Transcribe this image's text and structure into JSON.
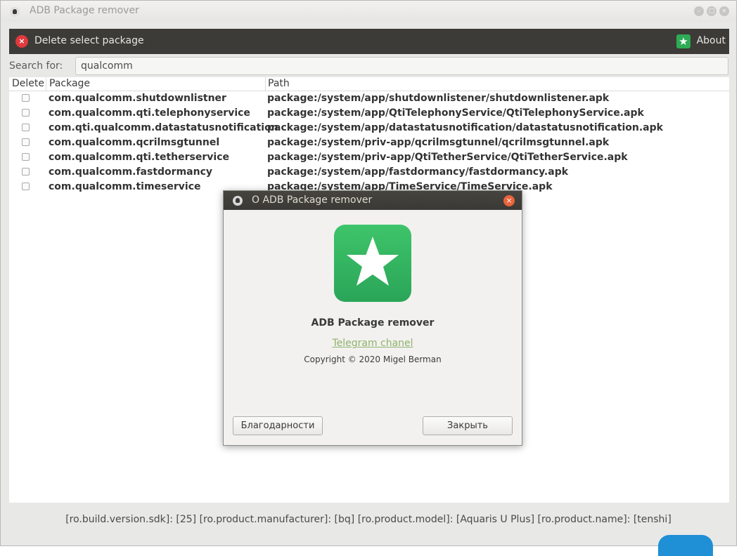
{
  "window": {
    "title": "ADB Package remover",
    "controls": [
      "–",
      "□",
      "×"
    ]
  },
  "toolbar": {
    "delete_label": "Delete select package",
    "about_label": "About",
    "delete_icon_glyph": "×",
    "about_icon_glyph": "★"
  },
  "search": {
    "label": "Search for:",
    "value": "qualcomm"
  },
  "table": {
    "headers": {
      "delete": "Delete",
      "package": "Package",
      "path": "Path"
    },
    "rows": [
      {
        "package": "com.qualcomm.shutdownlistner",
        "path": "package:/system/app/shutdownlistener/shutdownlistener.apk",
        "checked": false
      },
      {
        "package": "com.qualcomm.qti.telephonyservice",
        "path": "package:/system/app/QtiTelephonyService/QtiTelephonyService.apk",
        "checked": false
      },
      {
        "package": "com.qti.qualcomm.datastatusnotification",
        "path": "package:/system/app/datastatusnotification/datastatusnotification.apk",
        "checked": false
      },
      {
        "package": "com.qualcomm.qcrilmsgtunnel",
        "path": "package:/system/priv-app/qcrilmsgtunnel/qcrilmsgtunnel.apk",
        "checked": false
      },
      {
        "package": "com.qualcomm.qti.tetherservice",
        "path": "package:/system/priv-app/QtiTetherService/QtiTetherService.apk",
        "checked": false
      },
      {
        "package": "com.qualcomm.fastdormancy",
        "path": "package:/system/app/fastdormancy/fastdormancy.apk",
        "checked": false
      },
      {
        "package": "com.qualcomm.timeservice",
        "path": "package:/system/app/TimeService/TimeService.apk",
        "checked": false
      }
    ]
  },
  "status_bar": "[ro.build.version.sdk]: [25] [ro.product.manufacturer]: [bq] [ro.product.model]: [Aquaris U Plus] [ro.product.name]: [tenshi]",
  "about_dialog": {
    "title": "О ADB Package remover",
    "app_name": "ADB Package remover",
    "link": "Telegram chanel",
    "copyright": "Copyright © 2020 Migel Berman",
    "credits_button": "Благодарности",
    "close_button": "Закрыть",
    "close_glyph": "×"
  },
  "colors": {
    "toolbar_bg": "#3c3b37",
    "delete_icon": "#e03a3e",
    "about_icon": "#2eab55",
    "dialog_close": "#e9643c",
    "link": "#8fb36a"
  }
}
